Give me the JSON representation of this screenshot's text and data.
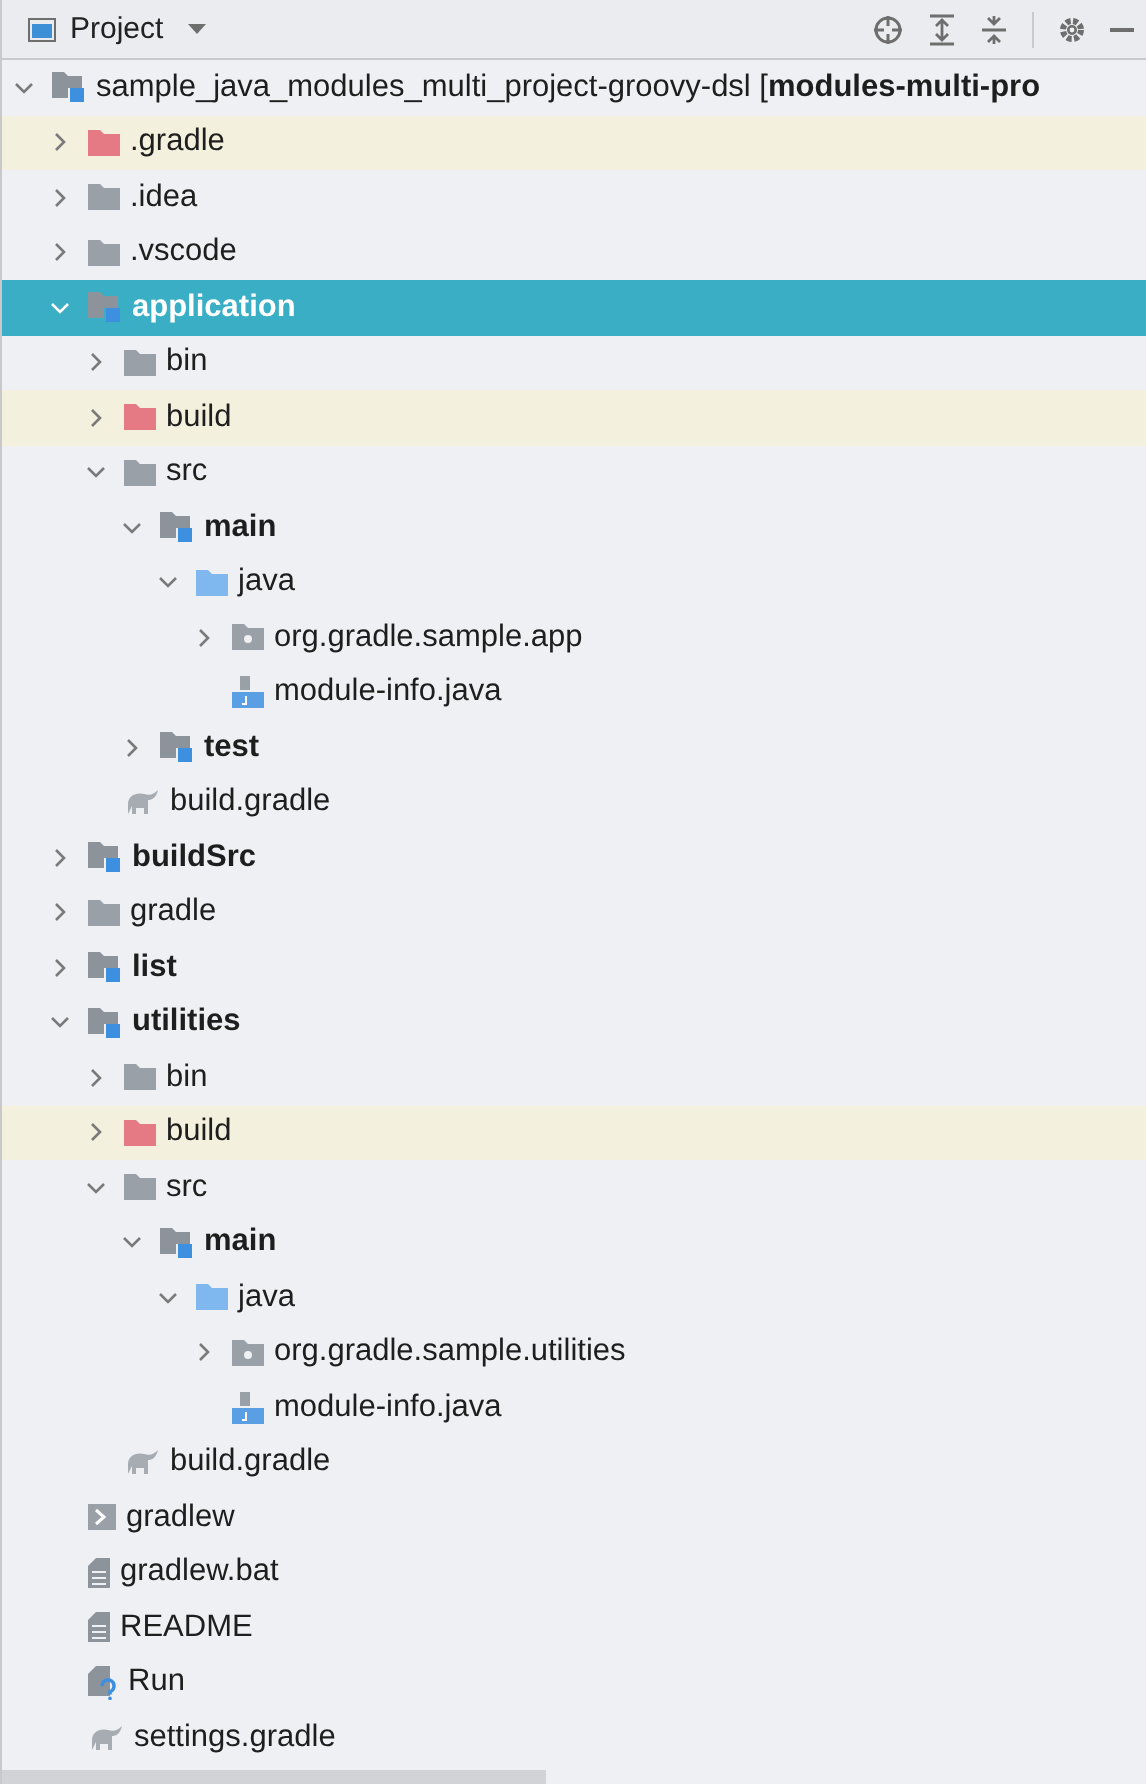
{
  "panel": {
    "title": "Project"
  },
  "tree": [
    {
      "label": "sample_java_modules_multi_project-groovy-dsl [**modules-multi-pro**",
      "kind": "module",
      "expanded": true,
      "selected": false,
      "children": [
        {
          "label": ".gradle",
          "kind": "excluded",
          "expanded": false,
          "selected": false
        },
        {
          "label": ".idea",
          "kind": "folder",
          "expanded": false,
          "selected": false
        },
        {
          "label": ".vscode",
          "kind": "folder",
          "expanded": false,
          "selected": false
        },
        {
          "label": "application",
          "kind": "module",
          "expanded": true,
          "selected": true,
          "children": [
            {
              "label": "bin",
              "kind": "folder",
              "expanded": false,
              "selected": false
            },
            {
              "label": "build",
              "kind": "excluded",
              "expanded": false,
              "selected": false
            },
            {
              "label": "src",
              "kind": "folder",
              "expanded": true,
              "selected": false,
              "children": [
                {
                  "label": "main",
                  "kind": "module",
                  "expanded": true,
                  "selected": false,
                  "children": [
                    {
                      "label": "java",
                      "kind": "source",
                      "expanded": true,
                      "selected": false,
                      "children": [
                        {
                          "label": "org.gradle.sample.app",
                          "kind": "package",
                          "expanded": false,
                          "selected": false
                        },
                        {
                          "label": "module-info.java",
                          "kind": "java",
                          "selected": false
                        }
                      ]
                    }
                  ]
                },
                {
                  "label": "test",
                  "kind": "module",
                  "expanded": false,
                  "selected": false
                }
              ]
            },
            {
              "label": "build.gradle",
              "kind": "gradle",
              "selected": false
            }
          ]
        },
        {
          "label": "buildSrc",
          "kind": "module",
          "expanded": false,
          "selected": false
        },
        {
          "label": "gradle",
          "kind": "folder",
          "expanded": false,
          "selected": false
        },
        {
          "label": "list",
          "kind": "module",
          "expanded": false,
          "selected": false
        },
        {
          "label": "utilities",
          "kind": "module",
          "expanded": true,
          "selected": false,
          "children": [
            {
              "label": "bin",
              "kind": "folder",
              "expanded": false,
              "selected": false
            },
            {
              "label": "build",
              "kind": "excluded",
              "expanded": false,
              "selected": false
            },
            {
              "label": "src",
              "kind": "folder",
              "expanded": true,
              "selected": false,
              "children": [
                {
                  "label": "main",
                  "kind": "module",
                  "expanded": true,
                  "selected": false,
                  "children": [
                    {
                      "label": "java",
                      "kind": "source",
                      "expanded": true,
                      "selected": false,
                      "children": [
                        {
                          "label": "org.gradle.sample.utilities",
                          "kind": "package",
                          "expanded": false,
                          "selected": false
                        },
                        {
                          "label": "module-info.java",
                          "kind": "java",
                          "selected": false
                        }
                      ]
                    }
                  ]
                }
              ]
            },
            {
              "label": "build.gradle",
              "kind": "gradle",
              "selected": false
            }
          ]
        },
        {
          "label": "gradlew",
          "kind": "script",
          "selected": false
        },
        {
          "label": "gradlew.bat",
          "kind": "text",
          "selected": false
        },
        {
          "label": "README",
          "kind": "text",
          "selected": false
        },
        {
          "label": "Run",
          "kind": "unknown",
          "selected": false
        },
        {
          "label": "settings.gradle",
          "kind": "gradle",
          "selected": false
        }
      ]
    }
  ]
}
